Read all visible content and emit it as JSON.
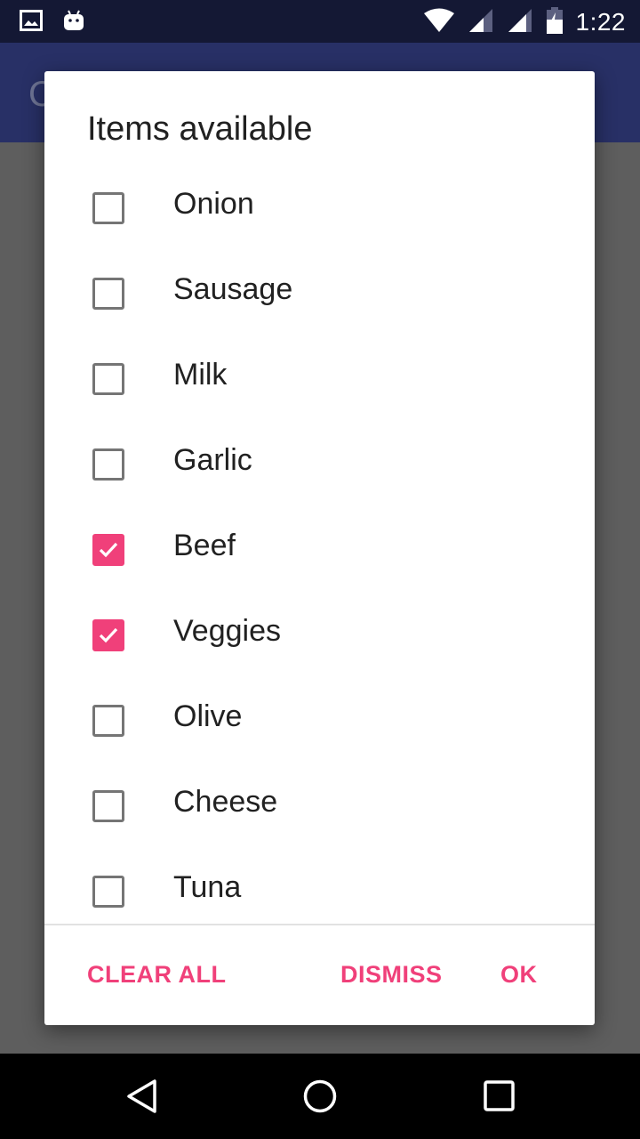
{
  "status_bar": {
    "time": "1:22",
    "icons": [
      "image-icon",
      "android-icon",
      "wifi-icon",
      "signal-icon",
      "signal-icon",
      "battery-charging-icon"
    ]
  },
  "app_bar": {
    "title": "C"
  },
  "dialog": {
    "title": "Items available",
    "items": [
      {
        "label": "Onion",
        "checked": false
      },
      {
        "label": "Sausage",
        "checked": false
      },
      {
        "label": "Milk",
        "checked": false
      },
      {
        "label": "Garlic",
        "checked": false
      },
      {
        "label": "Beef",
        "checked": true
      },
      {
        "label": "Veggies",
        "checked": true
      },
      {
        "label": "Olive",
        "checked": false
      },
      {
        "label": "Cheese",
        "checked": false
      },
      {
        "label": "Tuna",
        "checked": false
      }
    ],
    "buttons": {
      "clear_all": "CLEAR ALL",
      "dismiss": "DISMISS",
      "ok": "OK"
    },
    "accent_color": "#f0407a"
  },
  "nav_bar": {
    "icons": [
      "back-icon",
      "home-icon",
      "recents-icon"
    ]
  }
}
